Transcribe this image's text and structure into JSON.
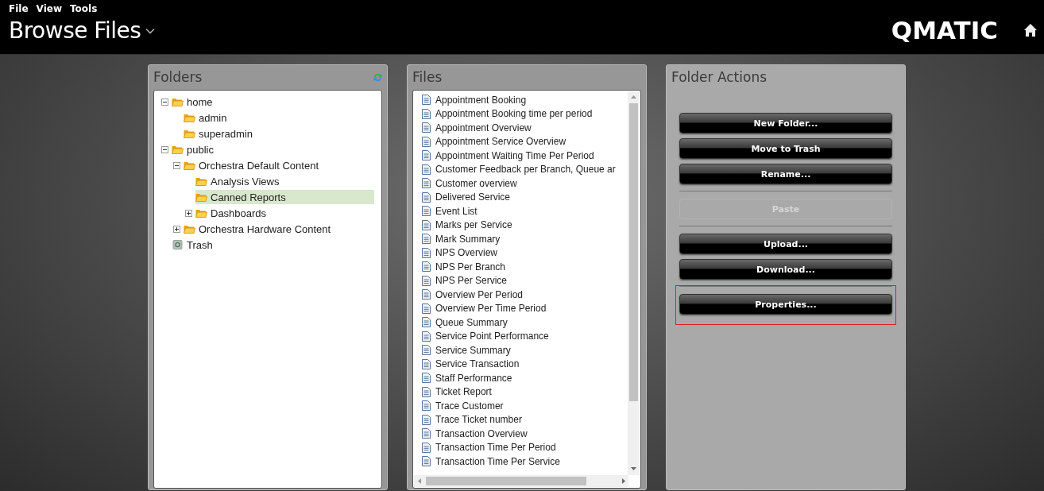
{
  "menu": [
    "File",
    "View",
    "Tools"
  ],
  "title": "Browse Files",
  "logo": "QMATIC",
  "folders": {
    "title": "Folders",
    "tree": [
      {
        "label": "home",
        "kind": "folder",
        "expanded": true,
        "selected": false,
        "children": [
          {
            "label": "admin",
            "kind": "folder",
            "selected": false
          },
          {
            "label": "superadmin",
            "kind": "folder",
            "selected": false
          }
        ]
      },
      {
        "label": "public",
        "kind": "folder",
        "expanded": true,
        "selected": false,
        "children": [
          {
            "label": "Orchestra Default Content",
            "kind": "folder",
            "expanded": true,
            "selected": false,
            "children": [
              {
                "label": "Analysis Views",
                "kind": "folder",
                "selected": false
              },
              {
                "label": "Canned Reports",
                "kind": "folder",
                "selected": true
              },
              {
                "label": "Dashboards",
                "kind": "folder",
                "expanded": false,
                "selected": false
              }
            ]
          },
          {
            "label": "Orchestra Hardware Content",
            "kind": "folder",
            "expanded": false,
            "selected": false
          }
        ]
      },
      {
        "label": "Trash",
        "kind": "trash",
        "selected": false
      }
    ]
  },
  "files": {
    "title": "Files",
    "items": [
      "Appointment Booking",
      "Appointment Booking time per period",
      "Appointment Overview",
      "Appointment Service Overview",
      "Appointment Waiting Time Per Period",
      "Customer Feedback per Branch, Queue ar",
      "Customer overview",
      "Delivered Service",
      "Event List",
      "Marks per Service",
      "Mark Summary",
      "NPS Overview",
      "NPS Per Branch",
      "NPS Per Service",
      "Overview Per Period",
      "Overview Per Time Period",
      "Queue Summary",
      "Service Point Performance",
      "Service Summary",
      "Service Transaction",
      "Staff Performance",
      "Ticket Report",
      "Trace Customer",
      "Trace Ticket number",
      "Transaction Overview",
      "Transaction Time Per Period",
      "Transaction Time Per Service"
    ]
  },
  "actions": {
    "title": "Folder Actions",
    "groups": [
      {
        "focused": false,
        "buttons": [
          {
            "label": "New Folder...",
            "disabled": false
          },
          {
            "label": "Move to Trash",
            "disabled": false
          },
          {
            "label": "Rename...",
            "disabled": false
          }
        ]
      },
      {
        "focused": false,
        "buttons": [
          {
            "label": "Paste",
            "disabled": true
          }
        ]
      },
      {
        "focused": false,
        "buttons": [
          {
            "label": "Upload...",
            "disabled": false
          },
          {
            "label": "Download...",
            "disabled": false
          }
        ]
      },
      {
        "focused": true,
        "buttons": [
          {
            "label": "Properties...",
            "disabled": false
          }
        ]
      }
    ]
  }
}
